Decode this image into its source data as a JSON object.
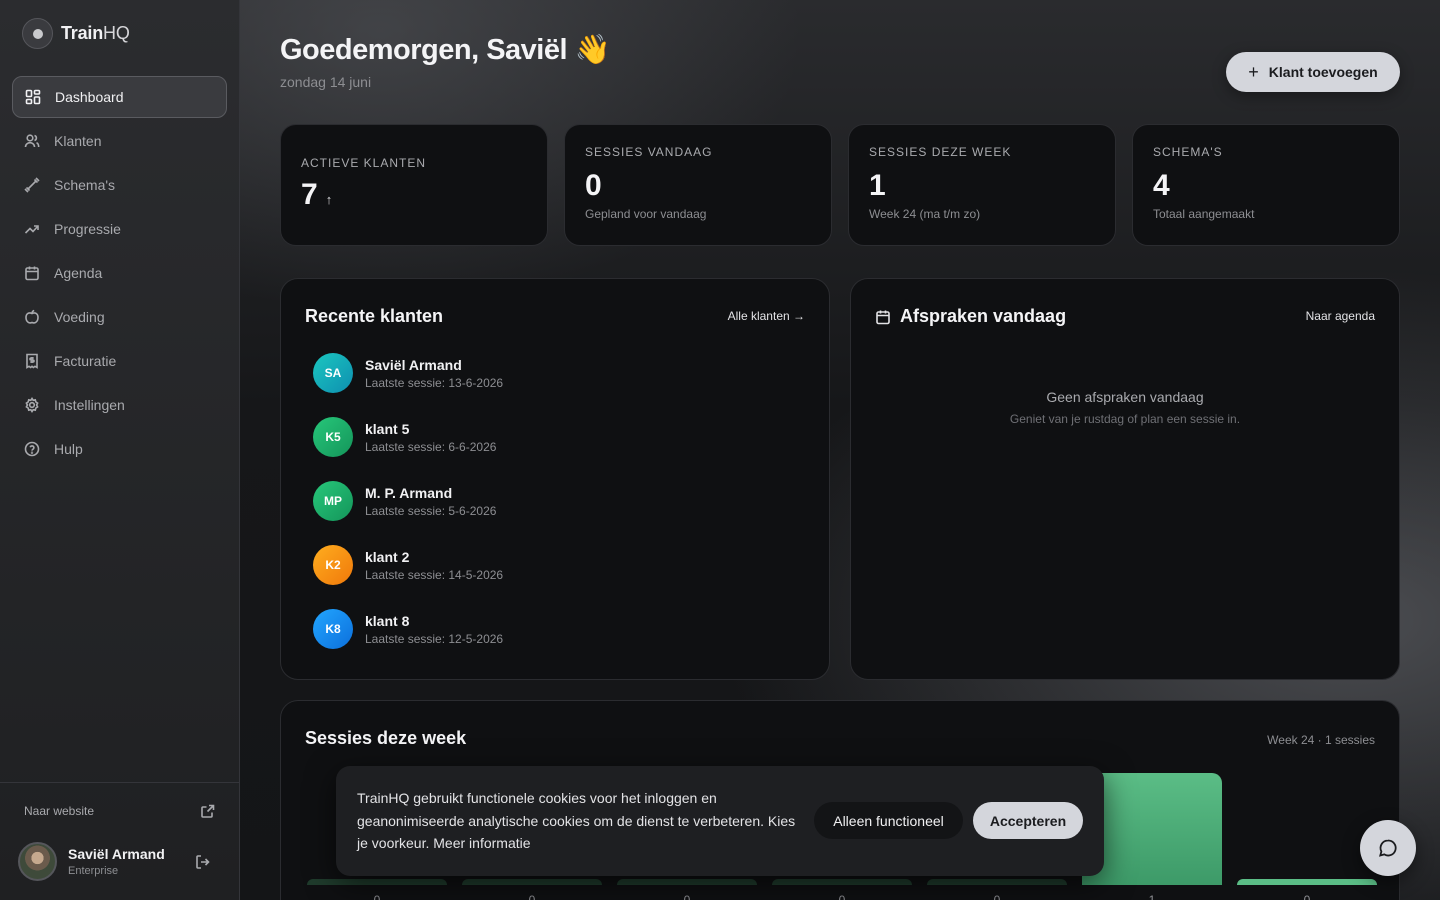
{
  "brand": {
    "name_main": "Train",
    "name_suffix": "HQ"
  },
  "sidebar": {
    "items": [
      {
        "label": "Dashboard",
        "icon": "dashboard-icon",
        "active": true
      },
      {
        "label": "Klanten",
        "icon": "users-icon"
      },
      {
        "label": "Schema's",
        "icon": "dumbbell-icon"
      },
      {
        "label": "Progressie",
        "icon": "trending-up-icon"
      },
      {
        "label": "Agenda",
        "icon": "calendar-icon"
      },
      {
        "label": "Voeding",
        "icon": "apple-icon"
      },
      {
        "label": "Facturatie",
        "icon": "receipt-icon"
      },
      {
        "label": "Instellingen",
        "icon": "gear-icon"
      },
      {
        "label": "Hulp",
        "icon": "help-icon"
      }
    ],
    "footer": {
      "website_link": "Naar website",
      "user_name": "Saviël Armand",
      "user_plan": "Enterprise"
    }
  },
  "header": {
    "greeting": "Goedemorgen, Saviël 👋",
    "date": "zondag 14 juni",
    "add_button": "Klant toevoegen"
  },
  "stats": [
    {
      "label": "ACTIEVE KLANTEN",
      "value": "7",
      "trend": "↑"
    },
    {
      "label": "SESSIES VANDAAG",
      "value": "0",
      "sub": "Gepland voor vandaag"
    },
    {
      "label": "SESSIES DEZE WEEK",
      "value": "1",
      "sub": "Week 24 (ma t/m zo)"
    },
    {
      "label": "SCHEMA'S",
      "value": "4",
      "sub": "Totaal aangemaakt"
    }
  ],
  "recent_clients": {
    "title": "Recente klanten",
    "link": "Alle klanten →",
    "clients": [
      {
        "initials": "SA",
        "name": "Saviël Armand",
        "last": "Laatste sessie: 13-6-2026",
        "color": "teal"
      },
      {
        "initials": "K5",
        "name": "klant 5",
        "last": "Laatste sessie: 6-6-2026",
        "color": "green"
      },
      {
        "initials": "MP",
        "name": "M. P. Armand",
        "last": "Laatste sessie: 5-6-2026",
        "color": "green"
      },
      {
        "initials": "K2",
        "name": "klant 2",
        "last": "Laatste sessie: 14-5-2026",
        "color": "orange"
      },
      {
        "initials": "K8",
        "name": "klant 8",
        "last": "Laatste sessie: 12-5-2026",
        "color": "blue"
      }
    ]
  },
  "appointments": {
    "title": "Afspraken vandaag",
    "link": "Naar agenda",
    "empty_title": "Geen afspraken vandaag",
    "empty_sub": "Geniet van je rustdag of plan een sessie in."
  },
  "sessions_week": {
    "title": "Sessies deze week",
    "meta": "Week 24 · 1 sessies"
  },
  "chart_data": {
    "type": "bar",
    "values": [
      0,
      0,
      0,
      0,
      0,
      1,
      0
    ],
    "value_labels": [
      "0",
      "0",
      "0",
      "0",
      "0",
      "1",
      "0"
    ]
  },
  "cookie": {
    "text": "TrainHQ gebruikt functionele cookies voor het inloggen en geanonimiseerde analytische cookies om de dienst te verbeteren. Kies je voorkeur. Meer informatie",
    "func_button": "Alleen functioneel",
    "accept_button": "Accepteren"
  },
  "colors": {
    "accent": "#d4d6dc",
    "bar_active": "#5bbd86",
    "bar_idle": "#1f3b2c",
    "teal": "#14a9b8",
    "green": "#1fb36a",
    "orange": "#f59312",
    "blue": "#1a8ff0"
  }
}
